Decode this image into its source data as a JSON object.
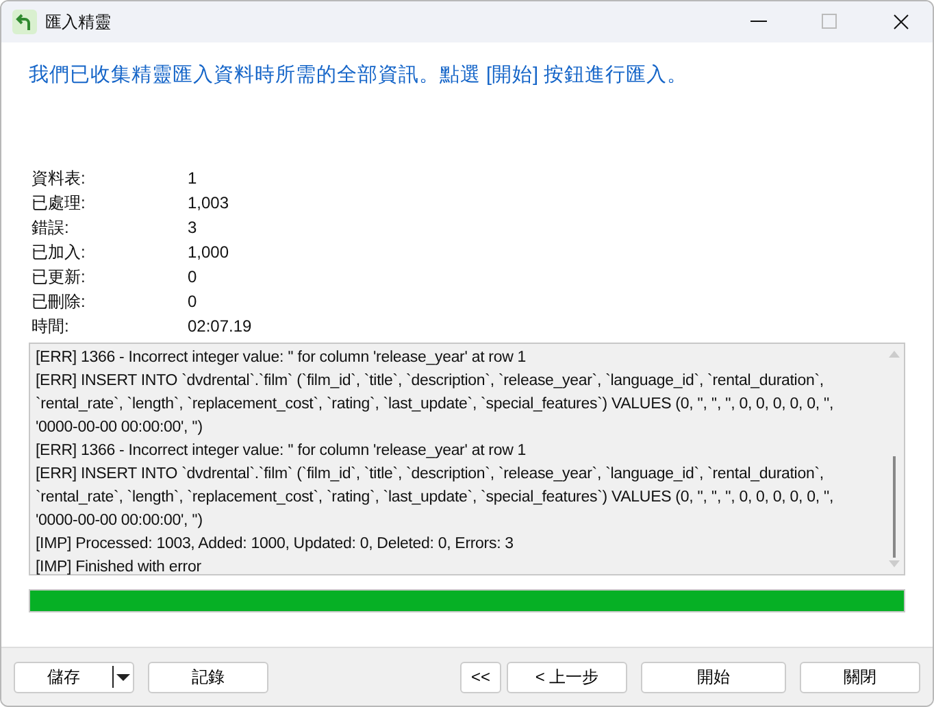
{
  "window": {
    "title": "匯入精靈"
  },
  "heading": "我們已收集精靈匯入資料時所需的全部資訊。點選 [開始] 按鈕進行匯入。",
  "stats": [
    {
      "label": "資料表:",
      "value": "1"
    },
    {
      "label": "已處理:",
      "value": "1,003"
    },
    {
      "label": "錯誤:",
      "value": "3"
    },
    {
      "label": "已加入:",
      "value": "1,000"
    },
    {
      "label": "已更新:",
      "value": "0"
    },
    {
      "label": "已刪除:",
      "value": "0"
    },
    {
      "label": "時間:",
      "value": "02:07.19"
    }
  ],
  "log": [
    "[ERR] 1366 - Incorrect integer value: '' for column 'release_year' at row 1",
    "[ERR] INSERT INTO `dvdrental`.`film` (`film_id`, `title`, `description`, `release_year`, `language_id`, `rental_duration`, `rental_rate`, `length`, `replacement_cost`, `rating`, `last_update`, `special_features`) VALUES (0, '', '', '', 0, 0, 0, 0, 0, '', '0000-00-00 00:00:00', '')",
    "[ERR] 1366 - Incorrect integer value: '' for column 'release_year' at row 1",
    "[ERR] INSERT INTO `dvdrental`.`film` (`film_id`, `title`, `description`, `release_year`, `language_id`, `rental_duration`, `rental_rate`, `length`, `replacement_cost`, `rating`, `last_update`, `special_features`) VALUES (0, '', '', '', 0, 0, 0, 0, 0, '', '0000-00-00 00:00:00', '')",
    "[IMP] Processed: 1003, Added: 1000, Updated: 0, Deleted: 0, Errors: 3",
    "[IMP] Finished with error"
  ],
  "progress": {
    "level": 1.0
  },
  "buttons_left": [
    {
      "label": "儲存",
      "kind": "split"
    },
    {
      "label": "記錄",
      "kind": "plain"
    }
  ],
  "buttons_right": [
    {
      "label": "<<",
      "kind": "small"
    },
    {
      "label": "< 上一步",
      "kind": "plain"
    },
    {
      "label": "開始",
      "kind": "wide"
    },
    {
      "label": "關閉",
      "kind": "plain"
    }
  ]
}
